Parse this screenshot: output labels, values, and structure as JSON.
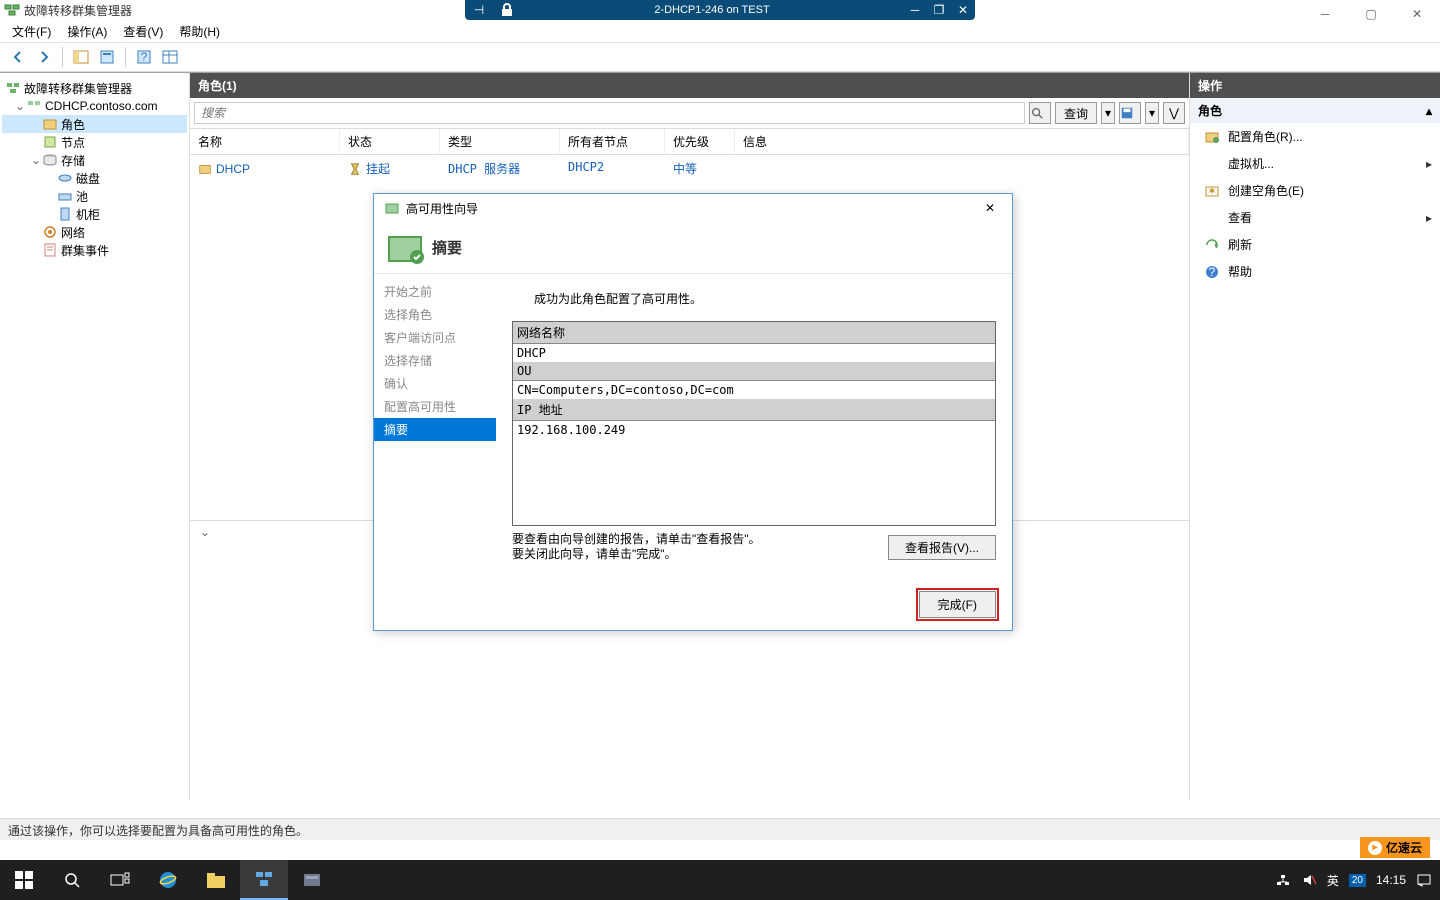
{
  "rdp": {
    "title": "2-DHCP1-246 on TEST"
  },
  "app": {
    "title": "故障转移群集管理器"
  },
  "menu": {
    "file": "文件(F)",
    "action": "操作(A)",
    "view": "查看(V)",
    "help": "帮助(H)"
  },
  "tree": {
    "root": "故障转移群集管理器",
    "cluster": "CDHCP.contoso.com",
    "roles": "角色",
    "nodes": "节点",
    "storage": "存储",
    "disks": "磁盘",
    "pools": "池",
    "cabinet": "机柜",
    "networks": "网络",
    "events": "群集事件"
  },
  "center": {
    "title": "角色(1)",
    "search_placeholder": "搜索",
    "query_btn": "查询",
    "cols": {
      "name": "名称",
      "state": "状态",
      "type": "类型",
      "owner": "所有者节点",
      "priority": "优先级",
      "info": "信息"
    },
    "row": {
      "name": "DHCP",
      "state": "挂起",
      "type": "DHCP 服务器",
      "owner": "DHCP2",
      "priority": "中等",
      "info": ""
    }
  },
  "actions": {
    "title": "操作",
    "group": "角色",
    "items": {
      "configure": "配置角色(R)...",
      "vm": "虚拟机...",
      "create_empty": "创建空角色(E)",
      "view": "查看",
      "refresh": "刷新",
      "help": "帮助"
    }
  },
  "wizard": {
    "title": "高可用性向导",
    "heading": "摘要",
    "steps": {
      "before": "开始之前",
      "select_role": "选择角色",
      "cap": "客户端访问点",
      "select_storage": "选择存储",
      "confirm": "确认",
      "configure": "配置高可用性",
      "summary": "摘要"
    },
    "message": "成功为此角色配置了高可用性。",
    "table": {
      "net_name_h": "网络名称",
      "net_name_v": "DHCP",
      "ou_h": "OU",
      "ou_v": "CN=Computers,DC=contoso,DC=com",
      "ip_h": "IP 地址",
      "ip_v": "192.168.100.249"
    },
    "foot_text1": "要查看由向导创建的报告，请单击\"查看报告\"。",
    "foot_text2": "要关闭此向导，请单击\"完成\"。",
    "view_report_btn": "查看报告(V)...",
    "finish_btn": "完成(F)"
  },
  "statusbar": "通过该操作，你可以选择要配置为具备高可用性的角色。",
  "watermark": "亿速云",
  "tray": {
    "ime": "英",
    "ime2": "20",
    "time": "14:15"
  }
}
